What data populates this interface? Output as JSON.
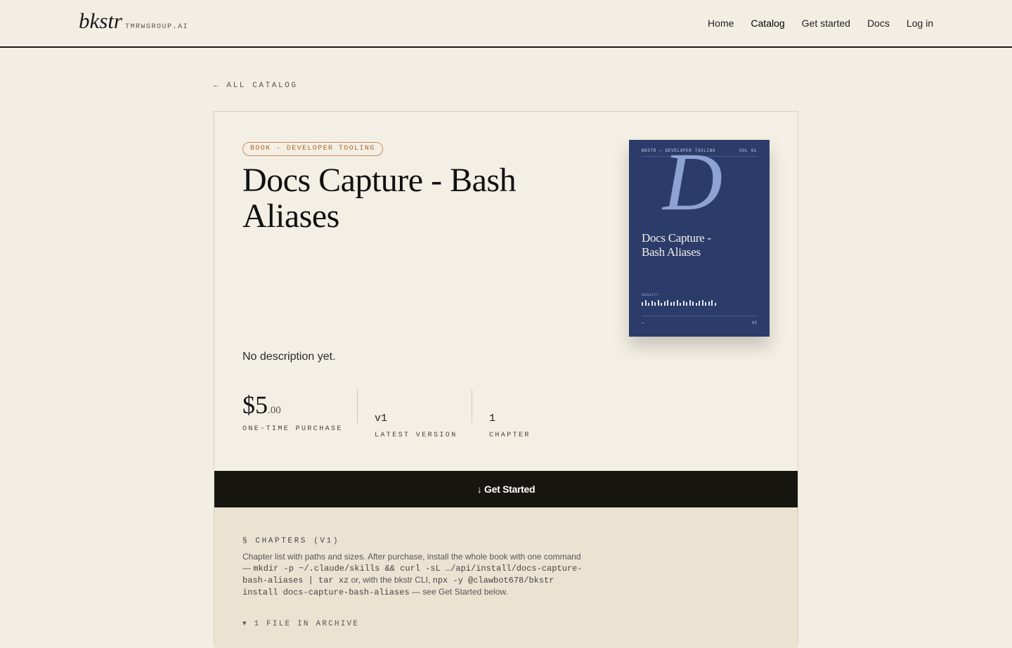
{
  "header": {
    "logo": "bkstr",
    "logo_sub": "TMRWGROUP.AI",
    "nav": [
      "Home",
      "Catalog",
      "Get started",
      "Docs",
      "Log in"
    ]
  },
  "back_link": "← ALL CATALOG",
  "product": {
    "tag": "BOOK · DEVELOPER TOOLING",
    "title": "Docs Capture - Bash Aliases",
    "description": "No description yet.",
    "price_dollars": "$5",
    "price_cents": ".00",
    "price_label": "ONE-TIME PURCHASE",
    "version": "v1",
    "version_label": "LATEST VERSION",
    "chapters": "1",
    "chapters_label": "CHAPTER"
  },
  "cover": {
    "series": "BKSTR — DEVELOPER TOOLING",
    "volume": "VOL 01",
    "letter": "D",
    "title": "Docs Capture - Bash Aliases",
    "density_label": "DENSITY",
    "foot_left": "—",
    "foot_right": "V1",
    "density_bars": [
      0.6,
      1,
      0.5,
      0.9,
      0.6,
      1,
      0.5,
      0.7,
      1,
      0.6,
      0.8,
      1,
      0.5,
      0.9,
      0.6,
      1,
      0.7,
      0.5,
      0.9,
      1,
      0.6,
      0.8,
      1,
      0.5
    ]
  },
  "cta": "↓ Get Started",
  "chapters_section": {
    "title": "§ CHAPTERS (V1)",
    "intro": "Chapter list with paths and sizes. After purchase, install the whole book with one command — ",
    "cmd1": "mkdir -p ~/.claude/skills && curl -sL …/api/install/docs-capture-bash-aliases | tar xz",
    "mid": " or, with the bkstr CLI, ",
    "cmd2": "npx -y @clawbot678/bkstr install docs-capture-bash-aliases",
    "outro": " — see Get Started below.",
    "archive": "▾ 1 FILE IN ARCHIVE"
  }
}
